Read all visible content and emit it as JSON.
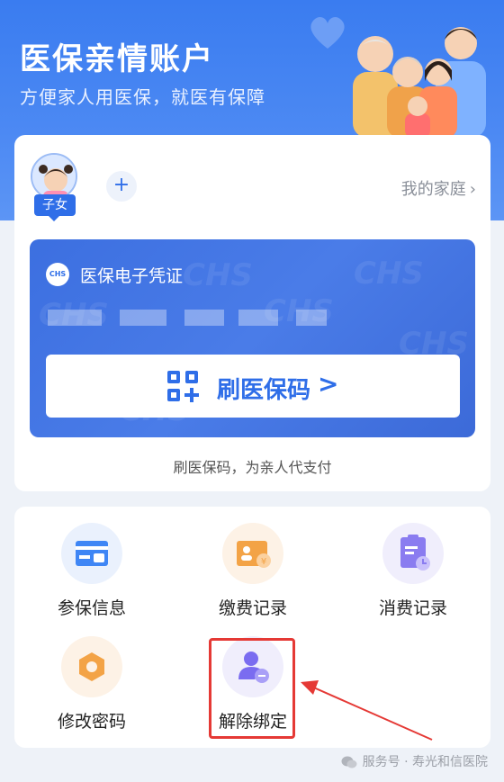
{
  "header": {
    "title": "医保亲情账户",
    "subtitle": "方便家人用医保，就医有保障"
  },
  "family": {
    "member_tag": "子女",
    "add_symbol": "+",
    "my_family_label": "我的家庭",
    "chevron": "›"
  },
  "certificate": {
    "logo_text": "CHS",
    "label": "医保电子凭证",
    "watermark": "CHS",
    "qr_button_label": "刷医保码",
    "qr_button_chevron": ">",
    "hint": "刷医保码，为亲人代支付"
  },
  "services": [
    {
      "label": "参保信息",
      "icon": "insurance-card-icon"
    },
    {
      "label": "缴费记录",
      "icon": "payment-record-icon"
    },
    {
      "label": "消费记录",
      "icon": "expense-record-icon"
    },
    {
      "label": "修改密码",
      "icon": "password-icon"
    },
    {
      "label": "解除绑定",
      "icon": "unbind-user-icon"
    }
  ],
  "footer": {
    "text": "服务号 · 寿光和信医院"
  },
  "colors": {
    "primary": "#2f6ee8",
    "header": "#3a7cf0",
    "highlight": "#e53935"
  }
}
